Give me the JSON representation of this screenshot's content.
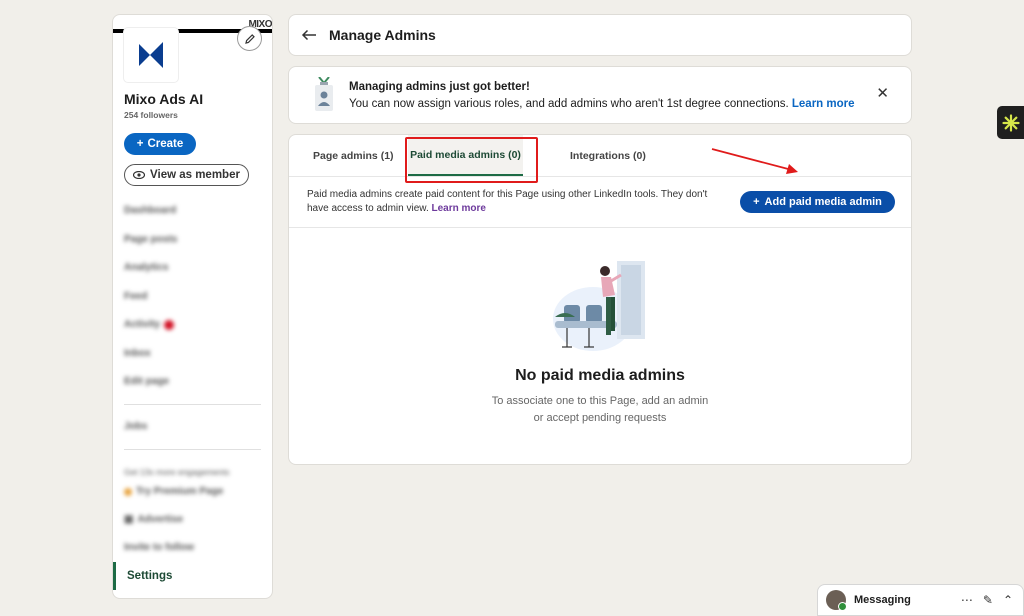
{
  "sidebar": {
    "cover_text": "MIXO",
    "company_name": "Mixo Ads AI",
    "followers": "254 followers",
    "create_label": "Create",
    "view_as_member_label": "View as member",
    "nav_items": [
      "Dashboard",
      "Page posts",
      "Analytics",
      "Feed",
      "Activity",
      "Inbox",
      "Edit page"
    ],
    "jobs_label": "Jobs",
    "promo_heading": "Get 13x more engagements",
    "premium_label": "Try Premium Page",
    "advertise_label": "Advertise",
    "invite_label": "Invite to follow",
    "settings_label": "Settings"
  },
  "header": {
    "title": "Manage Admins"
  },
  "banner": {
    "title": "Managing admins just got better!",
    "text": "You can now assign various roles, and add admins who aren't 1st degree connections.",
    "learn_more": "Learn more"
  },
  "tabs": [
    {
      "label": "Page admins (1)"
    },
    {
      "label": "Paid media admins (0)"
    },
    {
      "label": "Integrations (0)"
    }
  ],
  "content": {
    "description": "Paid media admins create paid content for this Page using other LinkedIn tools. They don't have access to admin view.",
    "learn_more": "Learn more",
    "add_button_label": "Add paid media admin",
    "empty_title": "No paid media admins",
    "empty_line1": "To associate one to this Page, add an admin",
    "empty_line2": "or accept pending requests"
  },
  "messaging": {
    "label": "Messaging"
  },
  "colors": {
    "primary_blue": "#0a66c2",
    "active_tab_green": "#1d6b45",
    "highlight_red": "#e01b1b"
  }
}
